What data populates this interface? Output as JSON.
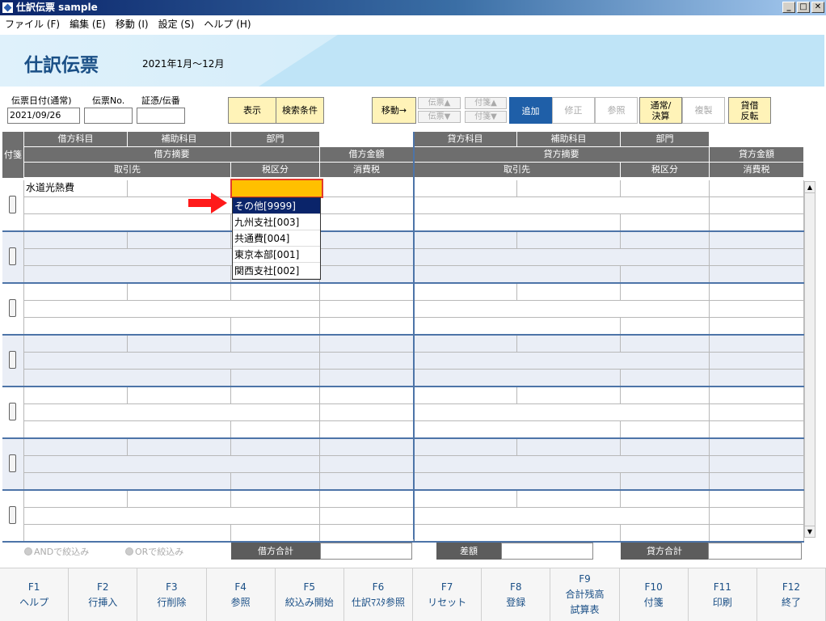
{
  "window": {
    "title": "仕訳伝票 sample",
    "min": "_",
    "max": "□",
    "close": "✕"
  },
  "menu": [
    "ファイル (F)",
    "編集 (E)",
    "移動 (I)",
    "設定 (S)",
    "ヘルプ (H)"
  ],
  "banner": {
    "title": "仕訳伝票",
    "period": "2021年1月～12月"
  },
  "toolbar": {
    "date_label": "伝票日付(通常)",
    "date_value": "2021/09/26",
    "no_label": "伝票No.",
    "no_value": "",
    "voucher_label": "証憑/伝番",
    "voucher_value": "",
    "display": "表示",
    "search": "検索条件",
    "move": "移動→",
    "denpyo_up": "伝票▲",
    "fusen_up": "付箋▲",
    "denpyo_down": "伝票▼",
    "fusen_down": "付箋▼",
    "add": "追加",
    "modify": "修正",
    "refer": "参照",
    "normal_line1": "通常/",
    "normal_line2": "決算",
    "copy": "複製",
    "swap_line1": "貸借",
    "swap_line2": "反転"
  },
  "grid": {
    "fusen": "付箋",
    "debit_account": "借方科目",
    "debit_sub": "補助科目",
    "debit_dept": "部門",
    "debit_summary": "借方摘要",
    "debit_amount": "借方金額",
    "debit_partner": "取引先",
    "debit_tax_class": "税区分",
    "debit_tax": "消費税",
    "credit_account": "貸方科目",
    "credit_sub": "補助科目",
    "credit_dept": "部門",
    "credit_summary": "貸方摘要",
    "credit_amount": "貸方金額",
    "credit_partner": "取引先",
    "credit_tax_class": "税区分",
    "credit_tax": "消費税",
    "row1_account": "水道光熱費"
  },
  "dropdown": [
    "その他[9999]",
    "九州支社[003]",
    "共通費[004]",
    "東京本部[001]",
    "関西支社[002]"
  ],
  "dropdown_selected": 0,
  "bottom": {
    "and": "ANDで絞込み",
    "or": "ORで絞込み",
    "debit_total": "借方合計",
    "diff": "差額",
    "credit_total": "貸方合計"
  },
  "fkeys": [
    {
      "key": "F1",
      "label": "ヘルプ"
    },
    {
      "key": "F2",
      "label": "行挿入"
    },
    {
      "key": "F3",
      "label": "行削除"
    },
    {
      "key": "F4",
      "label": "参照"
    },
    {
      "key": "F5",
      "label": "絞込み開始"
    },
    {
      "key": "F6",
      "label": "仕訳ﾏｽﾀ参照"
    },
    {
      "key": "F7",
      "label": "リセット"
    },
    {
      "key": "F8",
      "label": "登録"
    },
    {
      "key": "F9",
      "label": "合計残高",
      "label2": "試算表"
    },
    {
      "key": "F10",
      "label": "付箋"
    },
    {
      "key": "F11",
      "label": "印刷"
    },
    {
      "key": "F12",
      "label": "終了"
    }
  ],
  "colors": {
    "accent": "#1f5fa8",
    "header": "#6e6e6e",
    "highlight": "#ffc000",
    "band": "#eaeef6"
  }
}
